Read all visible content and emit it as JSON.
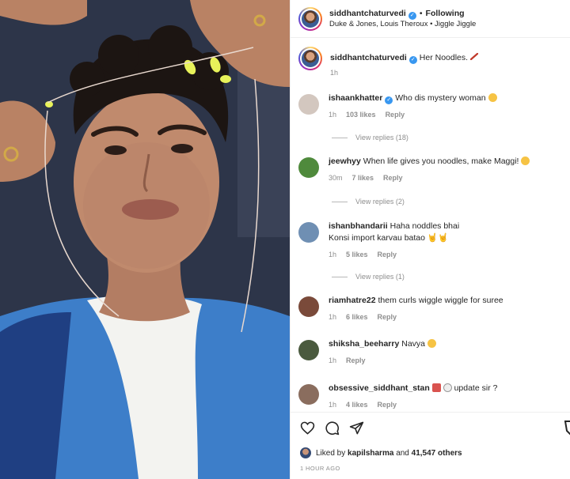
{
  "header": {
    "username": "siddhantchaturvedi",
    "follow_status": "Following",
    "separator": "•",
    "audio_line": "Duke & Jones, Louis Theroux • Jiggle Jiggle"
  },
  "caption": {
    "username": "siddhantchaturvedi",
    "text": "Her Noodles.",
    "time": "1h"
  },
  "comments": [
    {
      "username": "ishaankhatter",
      "verified": true,
      "text": "Who dis mystery woman",
      "time": "1h",
      "likes": "103 likes",
      "reply": "Reply",
      "view_replies": "View replies (18)",
      "avatar_color": "#d3c7bf"
    },
    {
      "username": "jeewhyy",
      "text": "When life gives you noodles, make Maggi!",
      "time": "30m",
      "likes": "7 likes",
      "reply": "Reply",
      "view_replies": "View replies (2)",
      "avatar_color": "#4f8a3c"
    },
    {
      "username": "ishanbhandarii",
      "text": "Haha noddles bhai",
      "text2": "Konsi import karvau batao 🤘🤘",
      "time": "1h",
      "likes": "5 likes",
      "reply": "Reply",
      "view_replies": "View replies (1)",
      "avatar_color": "#6f8fb3"
    },
    {
      "username": "riamhatre22",
      "text": "them curls wiggle wiggle for suree",
      "time": "1h",
      "likes": "6 likes",
      "reply": "Reply",
      "avatar_color": "#7a4a3a"
    },
    {
      "username": "shiksha_beeharry",
      "text": "Navya",
      "time": "1h",
      "reply": "Reply",
      "avatar_color": "#4a5a3e"
    },
    {
      "username": "obsessive_siddhant_stan",
      "text": "update sir ?",
      "time": "1h",
      "likes": "4 likes",
      "reply": "Reply",
      "avatar_color": "#8a6d5e"
    }
  ],
  "actions": {
    "liked_prefix": "Liked by",
    "liked_user": "kapilsharma",
    "liked_and": "and",
    "liked_others": "41,547 others",
    "timestamp": "1 HOUR AGO"
  },
  "icons": [
    "heart-icon",
    "comment-icon",
    "share-icon",
    "bookmark-icon",
    "verified-icon",
    "pencil-icon"
  ],
  "colors": {
    "verified_blue": "#3897f0",
    "muted_text": "#8e8e8e",
    "border": "#efefef"
  }
}
